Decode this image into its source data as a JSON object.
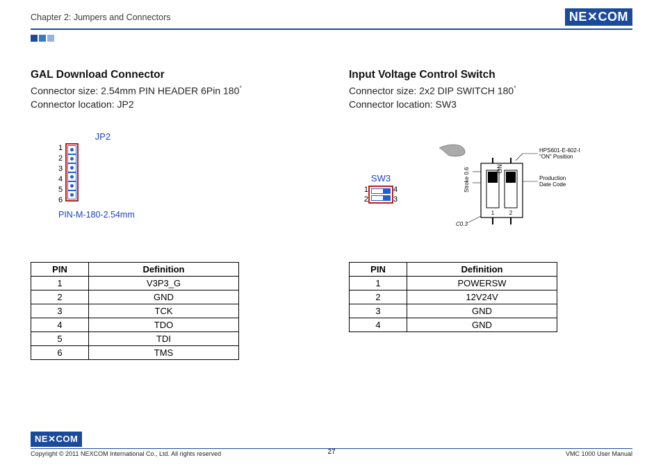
{
  "header": {
    "chapter": "Chapter 2: Jumpers and Connectors",
    "brand": "NE COM",
    "brand_x": "X"
  },
  "left": {
    "title": "GAL Download Connector",
    "size_label": "Connector size: 2.54mm PIN HEADER 6Pin 180",
    "degree": "°",
    "location": "Connector location: JP2",
    "diag_title": "JP2",
    "diag_label": "PIN-M-180-2.54mm",
    "pins": [
      "1",
      "2",
      "3",
      "4",
      "5",
      "6"
    ],
    "table": {
      "headers": [
        "PIN",
        "Definition"
      ],
      "rows": [
        [
          "1",
          "V3P3_G"
        ],
        [
          "2",
          "GND"
        ],
        [
          "3",
          "TCK"
        ],
        [
          "4",
          "TDO"
        ],
        [
          "5",
          "TDI"
        ],
        [
          "6",
          "TMS"
        ]
      ]
    }
  },
  "right": {
    "title": "Input Voltage Control Switch",
    "size_label": "Connector size: 2x2 DIP SWITCH 180",
    "degree": "°",
    "location": "Connector location: SW3",
    "diag_title": "SW3",
    "pins_left": [
      "1",
      "2"
    ],
    "pins_right": [
      "4",
      "3"
    ],
    "illus_text1": "HPS601-E-602-E",
    "illus_text2": "\"ON\" Position",
    "illus_text3": "Production",
    "illus_text4": "Date Code",
    "illus_stroke": "Stroke 0.6",
    "illus_on": "ON",
    "illus_sw_nums": "1 2",
    "illus_c": "C0.3",
    "table": {
      "headers": [
        "PIN",
        "Definition"
      ],
      "rows": [
        [
          "1",
          "POWERSW"
        ],
        [
          "2",
          "12V24V"
        ],
        [
          "3",
          "GND"
        ],
        [
          "4",
          "GND"
        ]
      ]
    }
  },
  "footer": {
    "copyright": "Copyright © 2011 NEXCOM International Co., Ltd. All rights reserved",
    "page": "27",
    "manual": "VMC 1000 User Manual"
  }
}
